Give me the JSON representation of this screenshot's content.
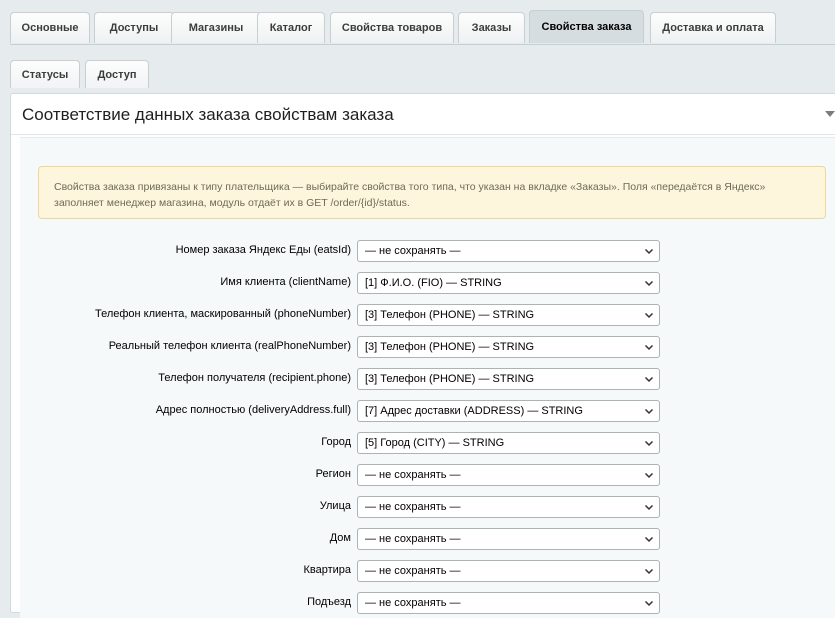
{
  "top_tabs": [
    {
      "label": "Основные"
    },
    {
      "label": "Доступы"
    },
    {
      "label": "Магазины"
    },
    {
      "label": "Каталог"
    },
    {
      "label": "Свойства товаров"
    },
    {
      "label": "Заказы"
    },
    {
      "label": "Свойства заказа",
      "active": true
    },
    {
      "label": "Доставка и оплата"
    }
  ],
  "sub_tabs": [
    {
      "label": "Статусы"
    },
    {
      "label": "Доступ"
    }
  ],
  "panel": {
    "title": "Соответствие данных заказа свойствам заказа"
  },
  "notice": {
    "text": "Свойства заказа привязаны к типу плательщика — выбирайте свойства того типа, что указан на вкладке «Заказы». Поля «передаётся в Яндекс» заполняет менеджер магазина, модуль отдаёт их в GET /order/{id}/status."
  },
  "fields": [
    {
      "label": "Номер заказа Яндекс Еды (eatsId)",
      "value": "— не сохранять —"
    },
    {
      "label": "Имя клиента (clientName)",
      "value": "[1] Ф.И.О. (FIO) — STRING"
    },
    {
      "label": "Телефон клиента, маскированный (phoneNumber)",
      "value": "[3] Телефон (PHONE) — STRING"
    },
    {
      "label": "Реальный телефон клиента (realPhoneNumber)",
      "value": "[3] Телефон (PHONE) — STRING"
    },
    {
      "label": "Телефон получателя (recipient.phone)",
      "value": "[3] Телефон (PHONE) — STRING"
    },
    {
      "label": "Адрес полностью (deliveryAddress.full)",
      "value": "[7] Адрес доставки (ADDRESS) — STRING"
    },
    {
      "label": "Город",
      "value": "[5] Город (CITY) — STRING"
    },
    {
      "label": "Регион",
      "value": "— не сохранять —"
    },
    {
      "label": "Улица",
      "value": "— не сохранять —"
    },
    {
      "label": "Дом",
      "value": "— не сохранять —"
    },
    {
      "label": "Квартира",
      "value": "— не сохранять —"
    },
    {
      "label": "Подъезд",
      "value": "— не сохранять —"
    }
  ]
}
